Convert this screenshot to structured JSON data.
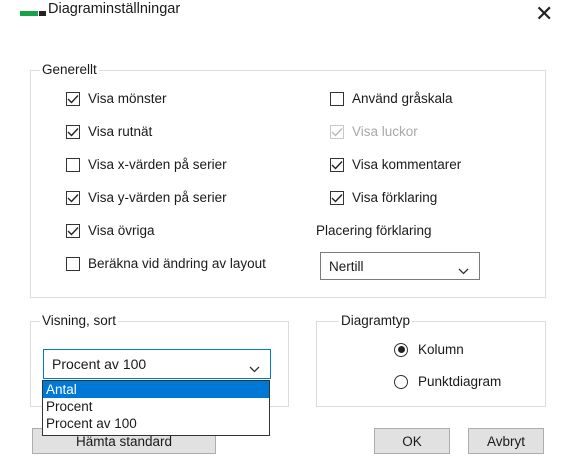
{
  "window": {
    "title": "Diagraminställningar",
    "app_icon": "chart-bars-icon",
    "close_glyph": "✕"
  },
  "general": {
    "legend": "Generellt",
    "left_options": [
      {
        "label": "Visa mönster",
        "checked": true
      },
      {
        "label": "Visa rutnät",
        "checked": true
      },
      {
        "label": "Visa  x-värden på serier",
        "checked": false
      },
      {
        "label": "Visa y-värden på serier",
        "checked": true
      },
      {
        "label": "Visa övriga",
        "checked": true
      },
      {
        "label": "Beräkna vid ändring av layout",
        "checked": false
      }
    ],
    "right_options": [
      {
        "label": "Använd gråskala",
        "checked": false,
        "disabled": false
      },
      {
        "label": "Visa luckor",
        "checked": true,
        "disabled": true
      },
      {
        "label": "Visa kommentarer",
        "checked": true,
        "disabled": false
      },
      {
        "label": "Visa förklaring",
        "checked": true,
        "disabled": false
      }
    ],
    "legend_placement": {
      "label": "Placering förklaring",
      "value": "Nertill"
    }
  },
  "display_sort": {
    "legend": "Visning, sort",
    "value": "Procent av 100",
    "options": [
      "Antal",
      "Procent",
      "Procent av 100"
    ],
    "highlighted": "Antal"
  },
  "chart_type": {
    "legend": "Diagramtyp",
    "options": [
      {
        "label": "Kolumn",
        "checked": true
      },
      {
        "label": "Punktdiagram",
        "checked": false
      }
    ]
  },
  "buttons": {
    "restore": "Hämta standard",
    "ok": "OK",
    "cancel": "Avbryt"
  },
  "colors": {
    "accent": "#0078d7",
    "icon_green": "#16a34a"
  }
}
